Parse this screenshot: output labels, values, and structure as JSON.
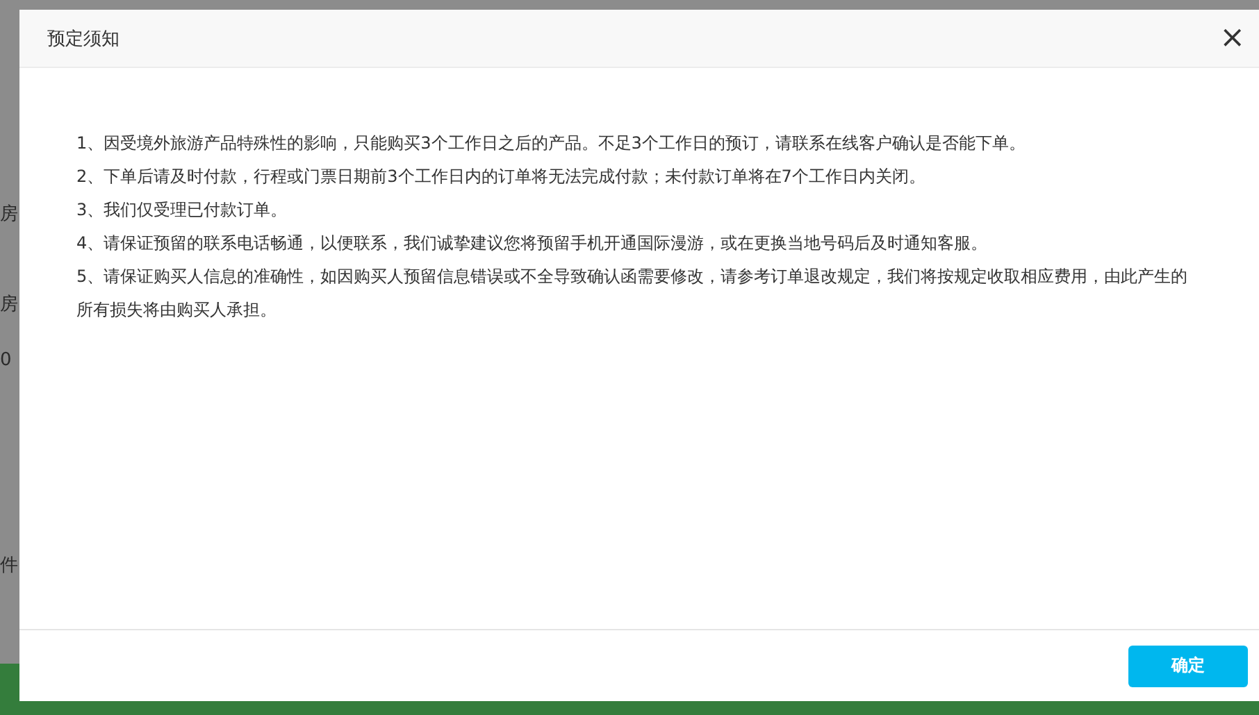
{
  "backdrop": {
    "fragments": [
      "房",
      "房",
      "0",
      "件"
    ]
  },
  "dialog": {
    "title": "预定须知",
    "close_icon": "×",
    "notes": [
      "1、因受境外旅游产品特殊性的影响，只能购买3个工作日之后的产品。不足3个工作日的预订，请联系在线客户确认是否能下单。",
      "2、下单后请及时付款，行程或门票日期前3个工作日内的订单将无法完成付款；未付款订单将在7个工作日内关闭。",
      "3、我们仅受理已付款订单。",
      "4、请保证预留的联系电话畅通，以便联系，我们诚挚建议您将预留手机开通国际漫游，或在更换当地号码后及时通知客服。",
      "5、请保证购买人信息的准确性，如因购买人预留信息错误或不全导致确认函需要修改，请参考订单退改规定，我们将按规定收取相应费用，由此产生的所有损失将由购买人承担。"
    ],
    "confirm_button": "确定"
  }
}
